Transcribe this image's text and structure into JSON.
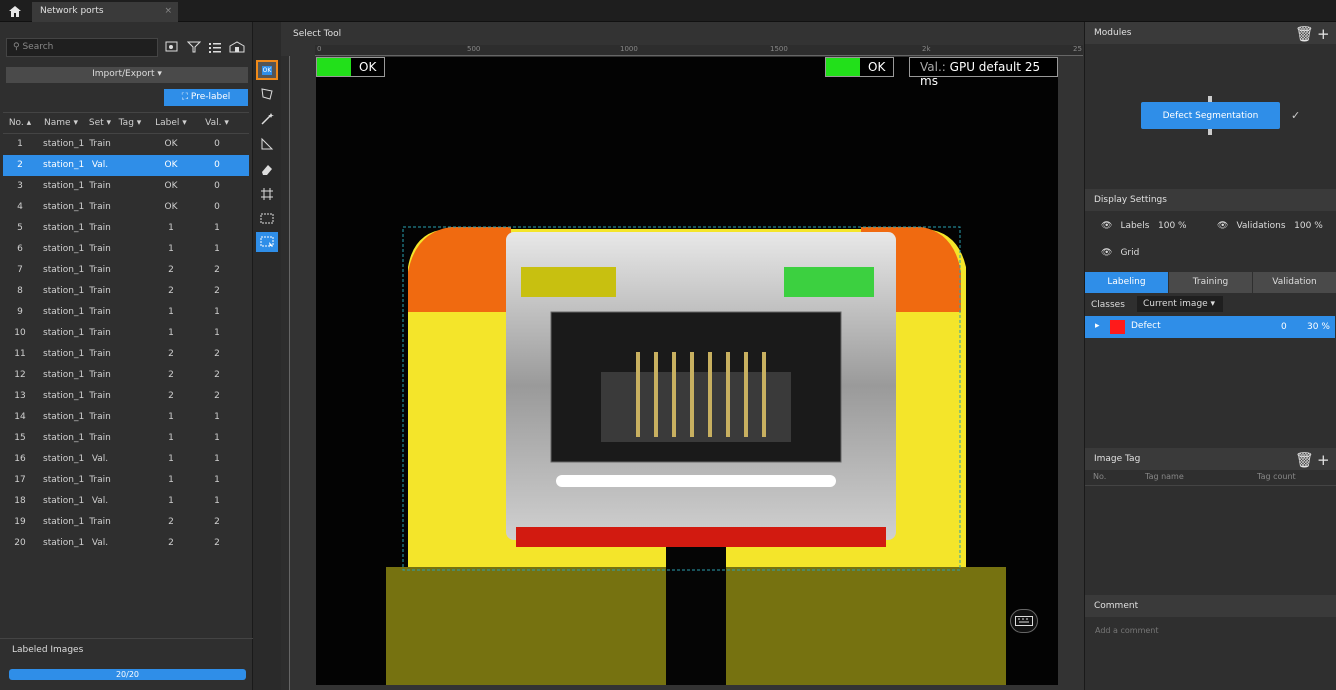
{
  "tab": {
    "title": "Network ports",
    "close": "×"
  },
  "left": {
    "search_placeholder": "Search",
    "import_export": "Import/Export ▾",
    "pre_label": "Pre-label",
    "columns": [
      "No.",
      "Name",
      "Set",
      "Tag",
      "Label",
      "Val."
    ],
    "rows": [
      [
        "1",
        "station_1...",
        "Train",
        "",
        "OK",
        "0"
      ],
      [
        "2",
        "station_1...",
        "Val.",
        "",
        "OK",
        "0"
      ],
      [
        "3",
        "station_1...",
        "Train",
        "",
        "OK",
        "0"
      ],
      [
        "4",
        "station_1...",
        "Train",
        "",
        "OK",
        "0"
      ],
      [
        "5",
        "station_1...",
        "Train",
        "",
        "1",
        "1"
      ],
      [
        "6",
        "station_1...",
        "Train",
        "",
        "1",
        "1"
      ],
      [
        "7",
        "station_1...",
        "Train",
        "",
        "2",
        "2"
      ],
      [
        "8",
        "station_1...",
        "Train",
        "",
        "2",
        "2"
      ],
      [
        "9",
        "station_1...",
        "Train",
        "",
        "1",
        "1"
      ],
      [
        "10",
        "station_1...",
        "Train",
        "",
        "1",
        "1"
      ],
      [
        "11",
        "station_1...",
        "Train",
        "",
        "2",
        "2"
      ],
      [
        "12",
        "station_1...",
        "Train",
        "",
        "2",
        "2"
      ],
      [
        "13",
        "station_1...",
        "Train",
        "",
        "2",
        "2"
      ],
      [
        "14",
        "station_1...",
        "Train",
        "",
        "1",
        "1"
      ],
      [
        "15",
        "station_1...",
        "Train",
        "",
        "1",
        "1"
      ],
      [
        "16",
        "station_1...",
        "Val.",
        "",
        "1",
        "1"
      ],
      [
        "17",
        "station_1...",
        "Train",
        "",
        "1",
        "1"
      ],
      [
        "18",
        "station_1...",
        "Val.",
        "",
        "1",
        "1"
      ],
      [
        "19",
        "station_1...",
        "Train",
        "",
        "2",
        "2"
      ],
      [
        "20",
        "station_1...",
        "Val.",
        "",
        "2",
        "2"
      ]
    ],
    "selected_row": 2,
    "labeled_title": "Labeled Images",
    "labeled_progress": "20/20",
    "labeled_fraction": 1.0
  },
  "center": {
    "title": "Select Tool",
    "ruler": [
      "0",
      "500",
      "1000",
      "1500",
      "2k",
      "25"
    ],
    "ok_left": "OK",
    "ok_right": "OK",
    "val_key": "Val.:",
    "val_text": "GPU default 25 ms"
  },
  "right": {
    "modules_title": "Modules",
    "module_name": "Defect Segmentation",
    "display_title": "Display Settings",
    "labels_text": "Labels",
    "labels_pct": "100 %",
    "validations_text": "Validations",
    "validations_pct": "100 %",
    "grid_text": "Grid",
    "tabs": [
      "Labeling",
      "Training",
      "Validation"
    ],
    "classes_label": "Classes",
    "classes_select": "Current image ▾",
    "defect_name": "Defect",
    "defect_count": "0",
    "defect_pct": "30 %",
    "image_tag_title": "Image Tag",
    "tag_cols": [
      "No.",
      "Tag name",
      "Tag count"
    ],
    "comment_title": "Comment",
    "comment_placeholder": "Add a comment"
  },
  "colors": {
    "accent": "#2f8ee8",
    "ok_green": "#22e01a",
    "defect_red": "#ff1a1a",
    "selection_orange": "#f08a1a"
  }
}
